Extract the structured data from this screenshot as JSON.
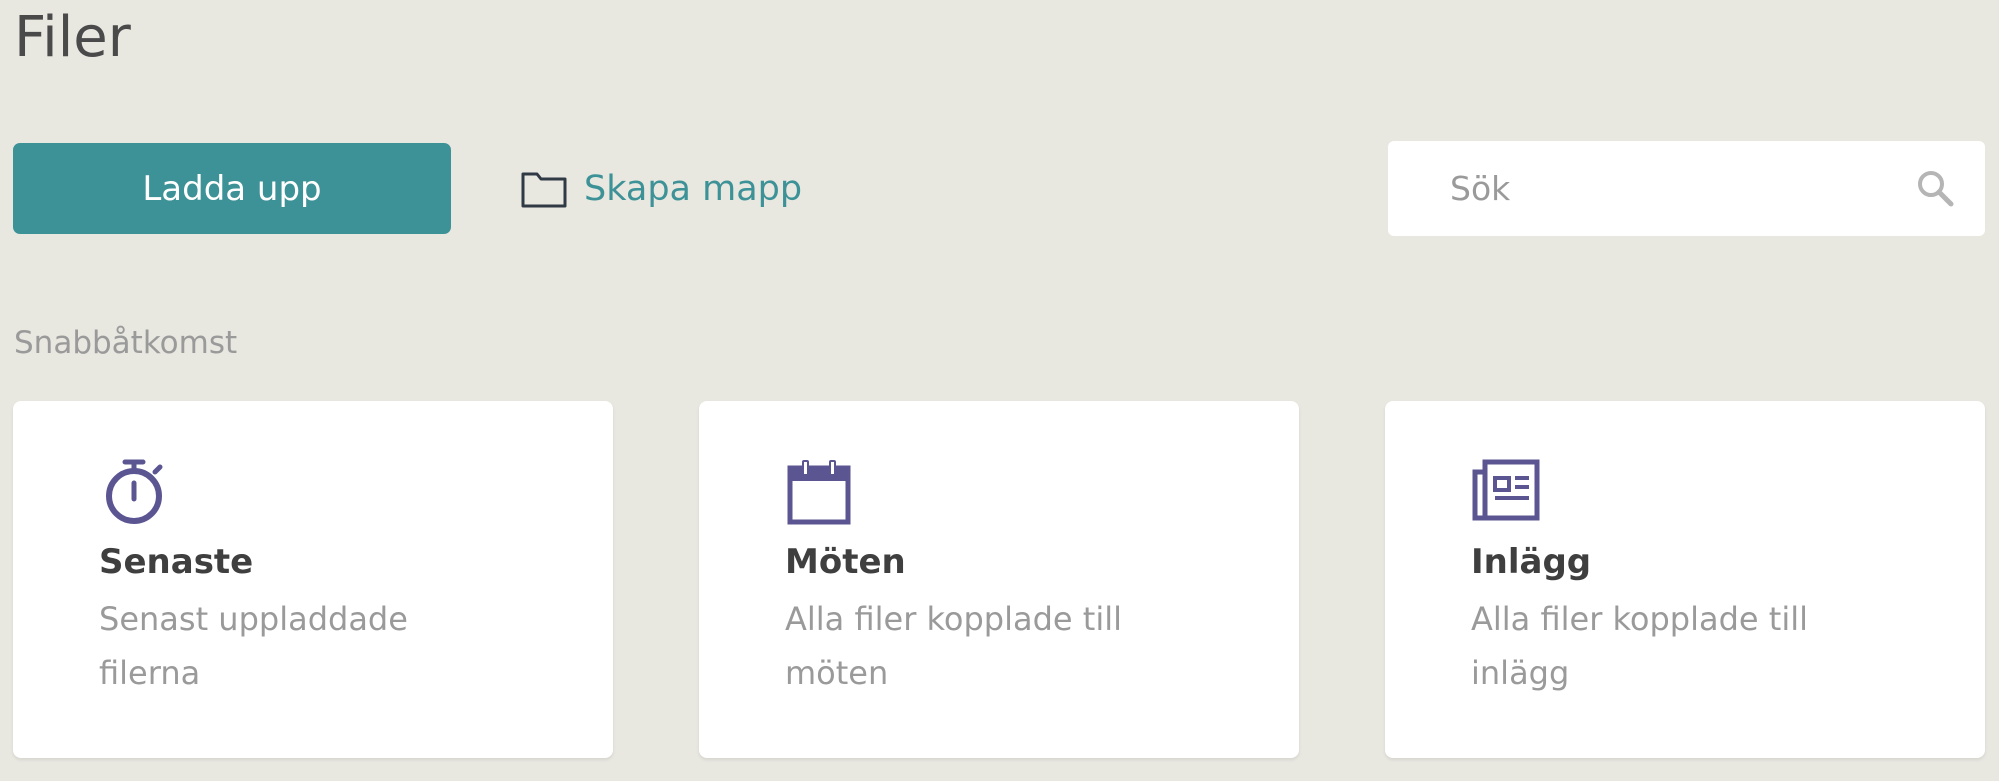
{
  "page": {
    "title": "Filer"
  },
  "toolbar": {
    "upload_label": "Ladda upp",
    "create_folder_label": "Skapa mapp"
  },
  "search": {
    "placeholder": "Sök",
    "value": ""
  },
  "quick_access": {
    "label": "Snabbåtkomst",
    "cards": [
      {
        "icon": "stopwatch-icon",
        "title": "Senaste",
        "description": "Senast uppladdade filerna"
      },
      {
        "icon": "calendar-icon",
        "title": "Möten",
        "description": "Alla filer kopplade till möten"
      },
      {
        "icon": "newspaper-icon",
        "title": "Inlägg",
        "description": "Alla filer kopplade till inlägg"
      }
    ]
  },
  "colors": {
    "background": "#e8e7e0",
    "accent": "#3d9297",
    "icon": "#5b5592",
    "card": "#ffffff"
  }
}
